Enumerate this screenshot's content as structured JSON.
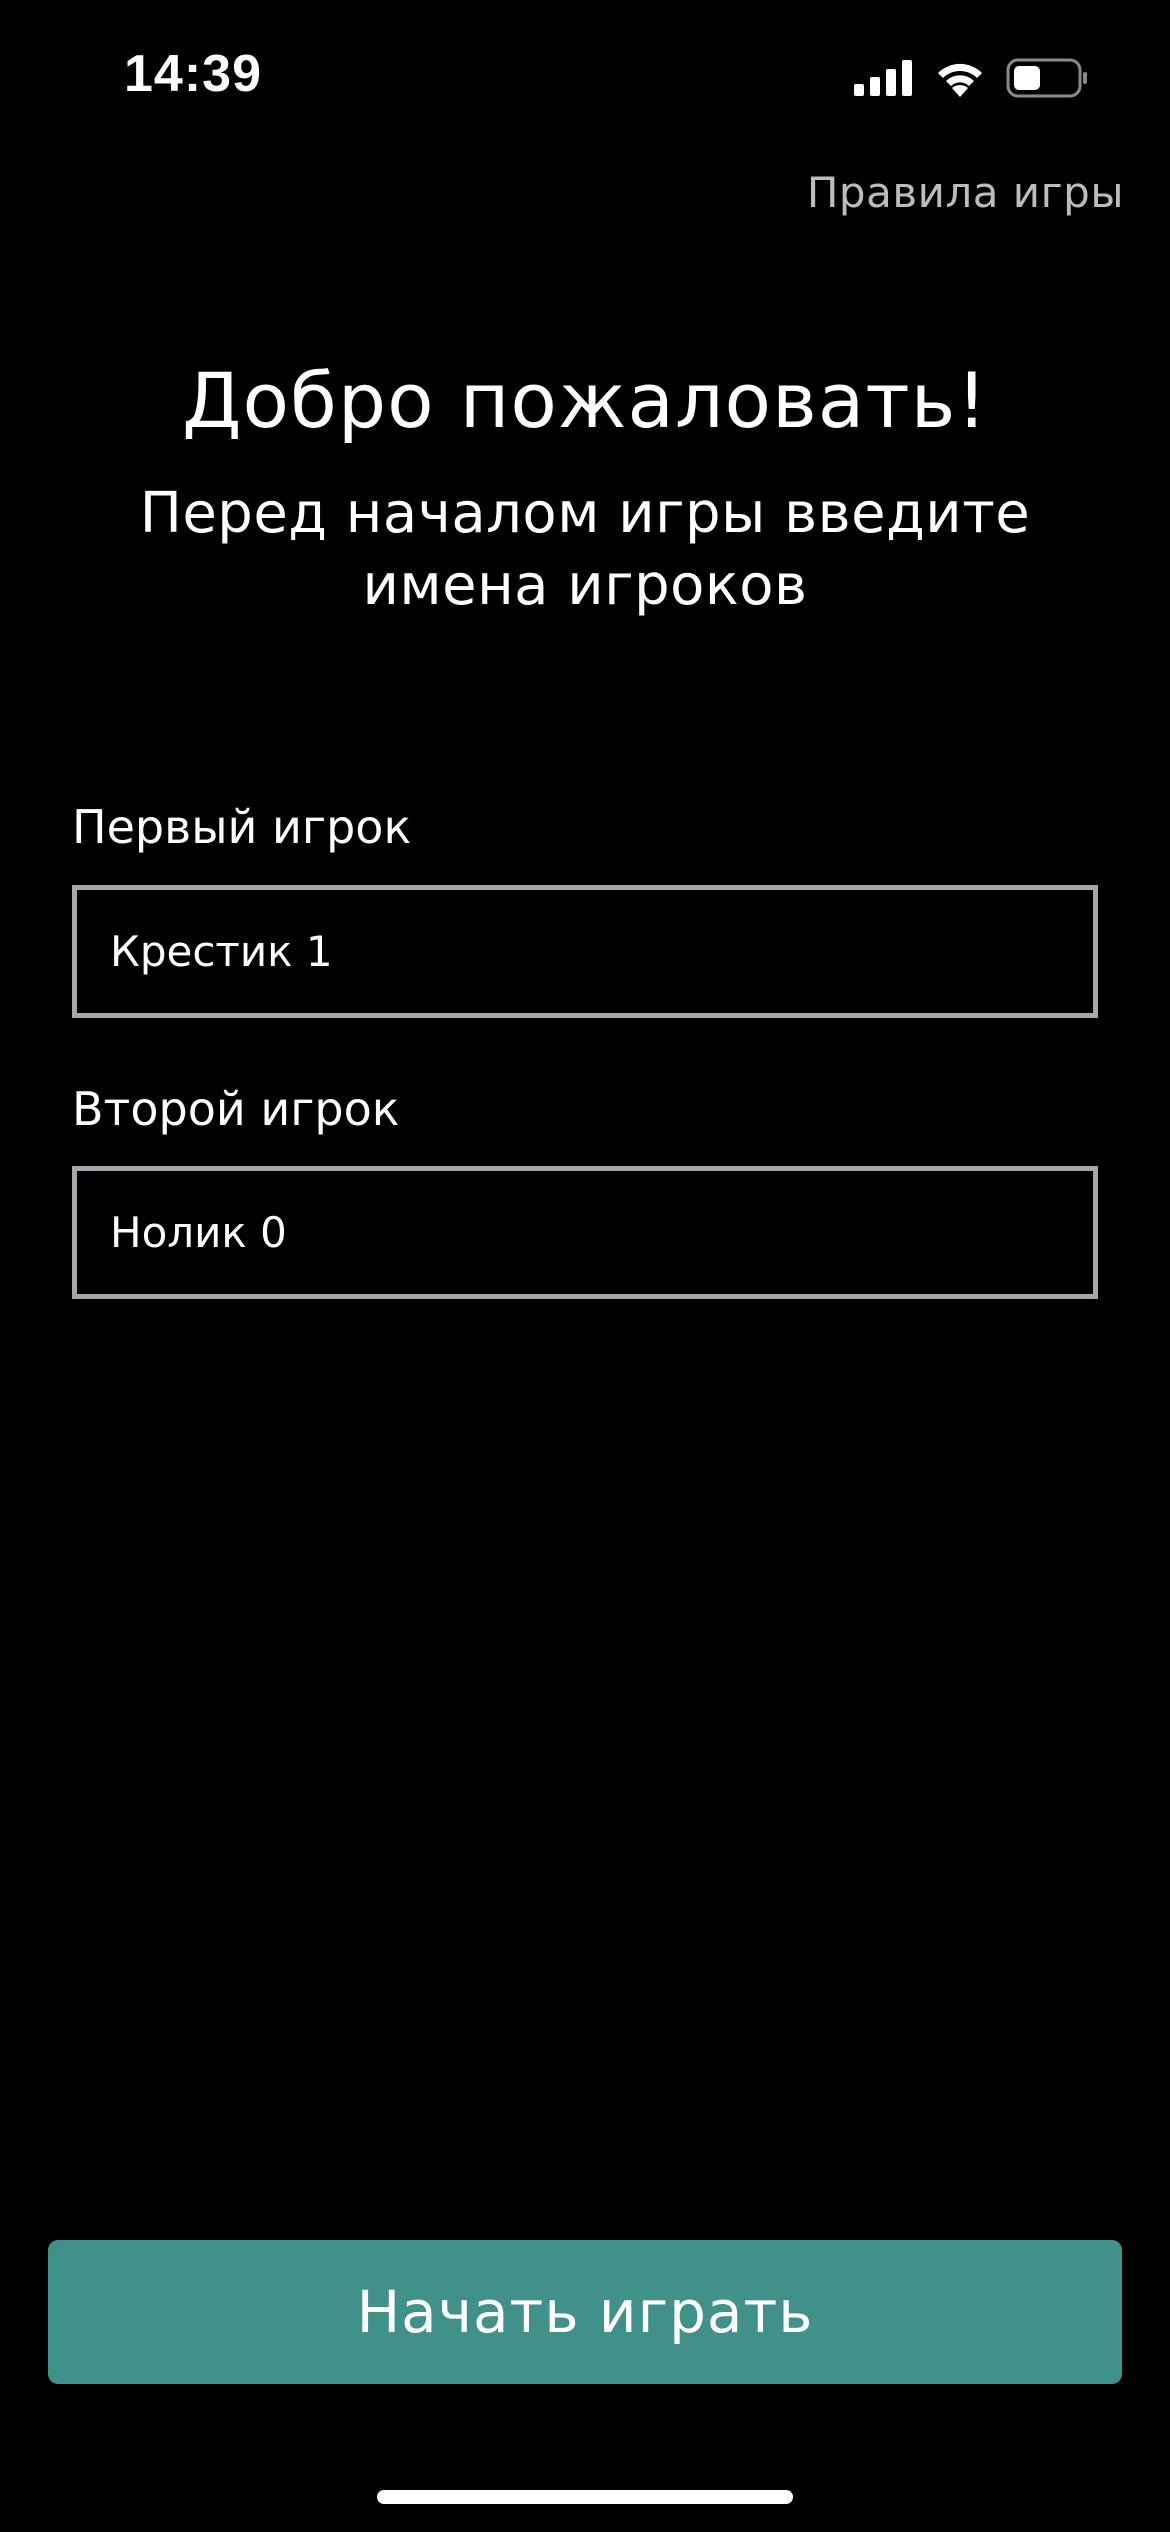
{
  "status_bar": {
    "time": "14:39",
    "icons": [
      "signal-icon",
      "wifi-icon",
      "battery-icon"
    ]
  },
  "header": {
    "rules_link": "Правила игры"
  },
  "welcome": {
    "title": "Добро пожаловать!",
    "subtitle": "Перед началом игры  введите имена игроков"
  },
  "players": {
    "first_label": "Первый игрок",
    "first_value": "Крестик 1",
    "second_label": "Второй игрок",
    "second_value": "Нолик 0"
  },
  "actions": {
    "start_label": "Начать играть"
  },
  "colors": {
    "background": "#000000",
    "accent": "#3f9189",
    "field_border": "#a4a8aa",
    "link": "#b9bdbd"
  }
}
